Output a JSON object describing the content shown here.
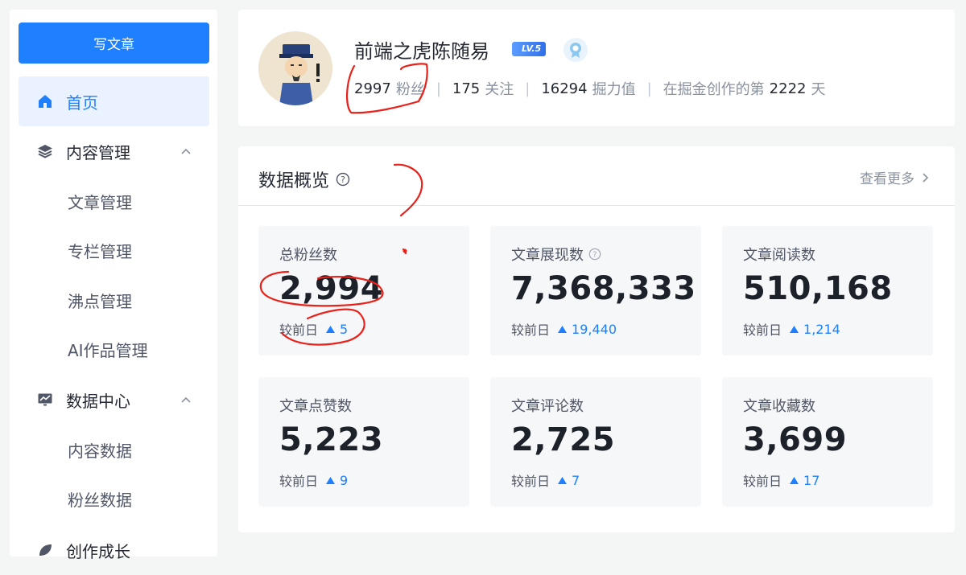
{
  "sidebar": {
    "write_label": "写文章",
    "items": [
      {
        "label": "首页",
        "icon": "home-icon",
        "active": true
      },
      {
        "label": "内容管理",
        "icon": "layers-icon",
        "expanded": true
      },
      {
        "label": "数据中心",
        "icon": "chart-icon",
        "expanded": true
      },
      {
        "label": "创作成长",
        "icon": "leaf-icon"
      }
    ],
    "content_sub": [
      "文章管理",
      "专栏管理",
      "沸点管理",
      "AI作品管理"
    ],
    "data_sub": [
      "内容数据",
      "粉丝数据"
    ]
  },
  "profile": {
    "username": "前端之虎陈随易",
    "level": "LV.5",
    "followers_count": "2997",
    "followers_label": "粉丝",
    "following_count": "175",
    "following_label": "关注",
    "power_count": "16294",
    "power_label": "掘力值",
    "days_prefix": "在掘金创作的第",
    "days_count": "2222",
    "days_suffix": "天"
  },
  "overview": {
    "title": "数据概览",
    "more_label": "查看更多",
    "delta_label": "较前日",
    "metrics": [
      {
        "label": "总粉丝数",
        "value": "2,994",
        "delta": "5",
        "help": false
      },
      {
        "label": "文章展现数",
        "value": "7,368,333",
        "delta": "19,440",
        "help": true
      },
      {
        "label": "文章阅读数",
        "value": "510,168",
        "delta": "1,214",
        "help": false
      },
      {
        "label": "文章点赞数",
        "value": "5,223",
        "delta": "9",
        "help": false
      },
      {
        "label": "文章评论数",
        "value": "2,725",
        "delta": "7",
        "help": false
      },
      {
        "label": "文章收藏数",
        "value": "3,699",
        "delta": "17",
        "help": false
      }
    ]
  },
  "colors": {
    "accent": "#1e80ff",
    "annotation": "#e8221b"
  }
}
